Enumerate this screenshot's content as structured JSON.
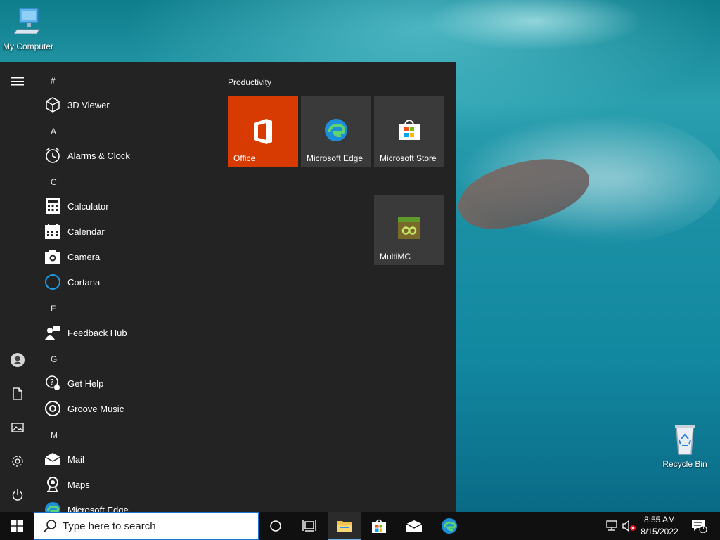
{
  "desktop": {
    "icons": [
      {
        "label": "My Computer",
        "icon": "computer-icon"
      },
      {
        "label": "Recycle Bin",
        "icon": "recycle-bin-icon"
      }
    ]
  },
  "start_menu": {
    "rail": [
      "hamburger-menu-icon",
      "user-account-icon",
      "documents-icon",
      "pictures-icon",
      "settings-icon",
      "power-icon"
    ],
    "letters": [
      "#",
      "A",
      "C",
      "F",
      "G",
      "M"
    ],
    "apps": [
      {
        "name": "3D Viewer",
        "icon": "3d-viewer-icon"
      },
      {
        "name": "Alarms & Clock",
        "icon": "alarm-clock-icon"
      },
      {
        "name": "Calculator",
        "icon": "calculator-icon"
      },
      {
        "name": "Calendar",
        "icon": "calendar-icon"
      },
      {
        "name": "Camera",
        "icon": "camera-icon"
      },
      {
        "name": "Cortana",
        "icon": "cortana-icon"
      },
      {
        "name": "Feedback Hub",
        "icon": "feedback-hub-icon"
      },
      {
        "name": "Get Help",
        "icon": "get-help-icon"
      },
      {
        "name": "Groove Music",
        "icon": "groove-music-icon"
      },
      {
        "name": "Mail",
        "icon": "mail-icon"
      },
      {
        "name": "Maps",
        "icon": "maps-icon"
      },
      {
        "name": "Microsoft Edge",
        "icon": "edge-icon"
      }
    ],
    "group_title": "Productivity",
    "tiles": [
      {
        "label": "Office",
        "icon": "office-icon",
        "color": "#d83b01"
      },
      {
        "label": "Microsoft Edge",
        "icon": "edge-icon",
        "color": "#3a3a3a"
      },
      {
        "label": "Microsoft Store",
        "icon": "store-icon",
        "color": "#3a3a3a"
      },
      {
        "label": "MultiMC",
        "icon": "multimc-icon",
        "color": "#3a3a3a"
      }
    ]
  },
  "taskbar": {
    "search_placeholder": "Type here to search",
    "pinned": [
      "start-windows-icon",
      "cortana-icon",
      "task-view-icon",
      "file-explorer-icon",
      "store-icon",
      "mail-icon",
      "edge-icon"
    ],
    "time": "8:55 AM",
    "date": "8/15/2022",
    "notification_count": "1"
  },
  "colors": {
    "start_bg": "#232323",
    "taskbar_bg": "#101010",
    "office_orange": "#d83b01",
    "accent": "#1a73d0"
  }
}
